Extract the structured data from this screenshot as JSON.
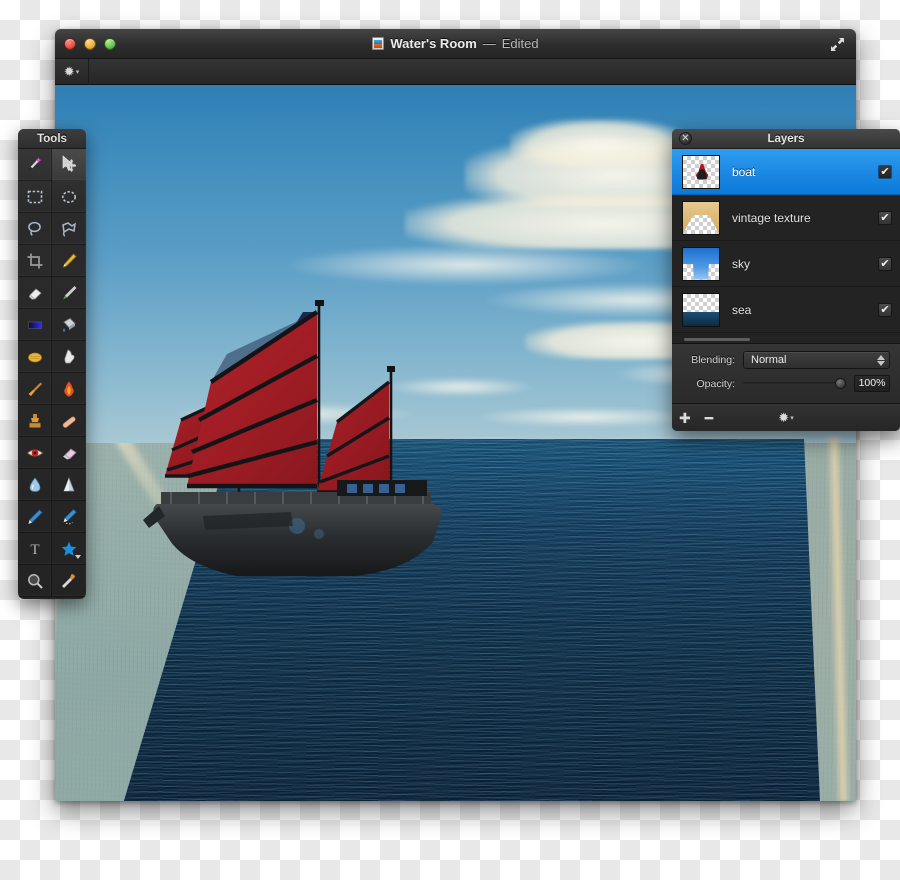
{
  "window": {
    "title_name": "Water's Room",
    "title_separator": "—",
    "title_state": "Edited",
    "doc_icon": "image-document-icon",
    "traffic_lights": [
      "close-button",
      "minimize-button",
      "zoom-button"
    ],
    "expand_icon": "expand-arrows-icon",
    "toolbar": {
      "gear_glyph": "✹",
      "gear_caret": "▾",
      "gear_name": "action-gear-menu"
    }
  },
  "tools": {
    "title": "Tools",
    "items": [
      {
        "name": "magic-wand-tool",
        "glyph": "✨",
        "active": false
      },
      {
        "name": "move-tool",
        "glyph": "✥",
        "active": true
      },
      {
        "name": "rectangular-marquee-tool",
        "glyph": "▭",
        "active": false
      },
      {
        "name": "elliptical-marquee-tool",
        "glyph": "◯",
        "active": false
      },
      {
        "name": "lasso-tool",
        "glyph": "◯",
        "active": false
      },
      {
        "name": "polygonal-lasso-tool",
        "glyph": "⌁",
        "active": false
      },
      {
        "name": "crop-tool",
        "glyph": "⌗",
        "active": false
      },
      {
        "name": "pencil-tool",
        "glyph": "✏",
        "active": false
      },
      {
        "name": "eraser-tool",
        "glyph": "▰",
        "active": false
      },
      {
        "name": "paintbrush-tool",
        "glyph": "🖌",
        "active": false
      },
      {
        "name": "gradient-tool",
        "glyph": "▬",
        "active": false
      },
      {
        "name": "paint-bucket-tool",
        "glyph": "🪣",
        "active": false
      },
      {
        "name": "sponge-tool",
        "glyph": "⬭",
        "active": false
      },
      {
        "name": "smudge-tool",
        "glyph": "☝",
        "active": false
      },
      {
        "name": "brush-tool",
        "glyph": "🧹",
        "active": false
      },
      {
        "name": "burn-tool",
        "glyph": "🔥",
        "active": false
      },
      {
        "name": "clone-stamp-tool",
        "glyph": "⬒",
        "active": false
      },
      {
        "name": "healing-brush-tool",
        "glyph": "▰",
        "active": false
      },
      {
        "name": "red-eye-tool",
        "glyph": "👁",
        "active": false
      },
      {
        "name": "eraser-block-tool",
        "glyph": "▱",
        "active": false
      },
      {
        "name": "blur-tool",
        "glyph": "💧",
        "active": false
      },
      {
        "name": "sharpen-tool",
        "glyph": "▲",
        "active": false
      },
      {
        "name": "pen-tool",
        "glyph": "✒",
        "active": false
      },
      {
        "name": "freeform-pen-tool",
        "glyph": "✒",
        "active": false
      },
      {
        "name": "type-tool",
        "glyph": "T",
        "active": false
      },
      {
        "name": "shape-tool",
        "glyph": "★",
        "active": false,
        "has_submenu": true
      },
      {
        "name": "zoom-tool",
        "glyph": "🔍",
        "active": false
      },
      {
        "name": "eyedropper-tool",
        "glyph": "💉",
        "active": false
      }
    ]
  },
  "layers_panel": {
    "title": "Layers",
    "close_glyph": "✕",
    "layers": [
      {
        "name": "boat",
        "thumb": "boat-thumbnail",
        "visible": true,
        "selected": true,
        "check_glyph": "✔"
      },
      {
        "name": "vintage texture",
        "thumb": "vintage-texture-thumbnail",
        "visible": true,
        "selected": false,
        "check_glyph": "✔"
      },
      {
        "name": "sky",
        "thumb": "sky-thumbnail",
        "visible": true,
        "selected": false,
        "check_glyph": "✔"
      },
      {
        "name": "sea",
        "thumb": "sea-thumbnail",
        "visible": true,
        "selected": false,
        "check_glyph": "✔"
      }
    ],
    "blending_label": "Blending:",
    "blending_value": "Normal",
    "opacity_label": "Opacity:",
    "opacity_value": "100%",
    "opacity_percent": 100,
    "footer": {
      "add_glyph": "✚",
      "remove_glyph": "━",
      "gear_glyph": "✹",
      "gear_caret": "▾"
    }
  },
  "colors": {
    "accent_selection": "#0b79d8",
    "panel_background": "#2a2a2a",
    "titlebar": "#2d2d2d",
    "sail_red": "#a81f27",
    "sea_deep": "#0b2b45",
    "sky_blue": "#3e8cbd",
    "vintage_paper": "#d2ab63"
  },
  "artwork": {
    "subject": "chinese-junk-sailboat-on-ocean",
    "sail_count": 3
  }
}
